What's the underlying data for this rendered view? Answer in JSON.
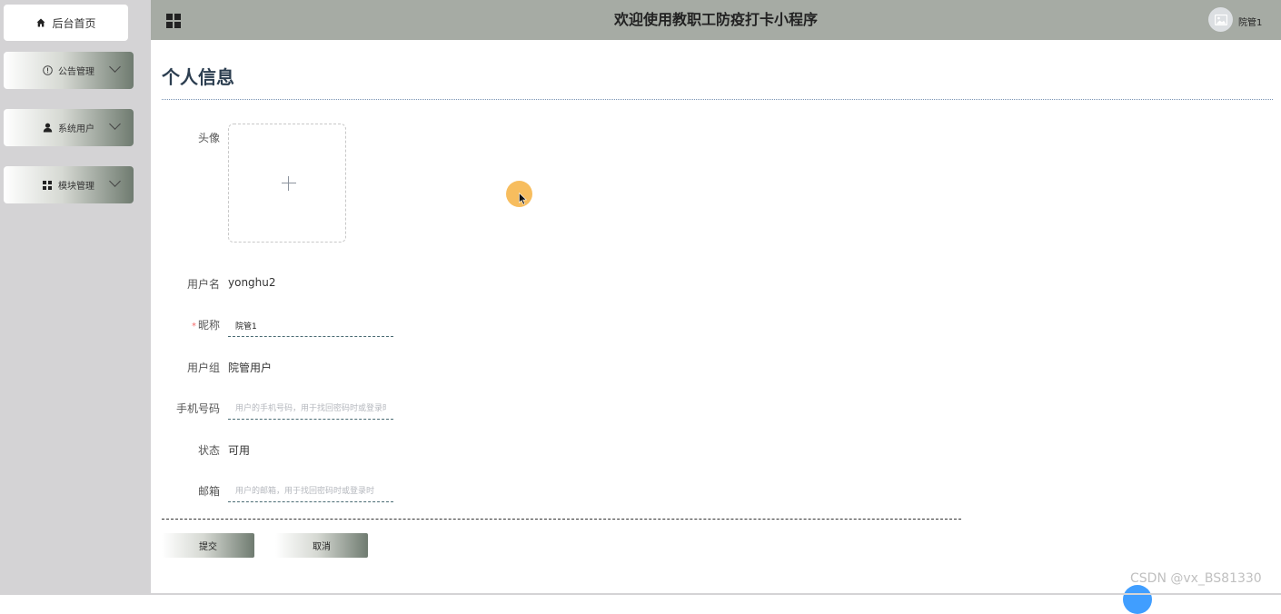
{
  "sidebar": {
    "items": [
      {
        "label": "后台首页",
        "icon": "home-icon"
      },
      {
        "label": "公告管理",
        "icon": "info-circle-icon"
      },
      {
        "label": "系统用户",
        "icon": "user-icon"
      },
      {
        "label": "模块管理",
        "icon": "grid-icon"
      }
    ]
  },
  "header": {
    "title": "欢迎使用教职工防疫打卡小程序",
    "user_name": "院管1"
  },
  "page": {
    "title": "个人信息"
  },
  "form": {
    "avatar_label": "头像",
    "username_label": "用户名",
    "username_value": "yonghu2",
    "nickname_label": "昵称",
    "nickname_required": "*",
    "nickname_value": "院管1",
    "group_label": "用户组",
    "group_value": "院管用户",
    "phone_label": "手机号码",
    "phone_placeholder": "用户的手机号码，用于找回密码时或登录时",
    "status_label": "状态",
    "status_value": "可用",
    "email_label": "邮箱",
    "email_placeholder": "用户的邮箱，用于找回密码时或登录时"
  },
  "actions": {
    "submit_label": "提交",
    "cancel_label": "取消"
  },
  "watermark": "CSDN @vx_BS81330",
  "colors": {
    "topbar": "#a6aba4",
    "sidebar": "#d4d3d5",
    "title": "#2c3e50",
    "required": "#f56c6c"
  }
}
